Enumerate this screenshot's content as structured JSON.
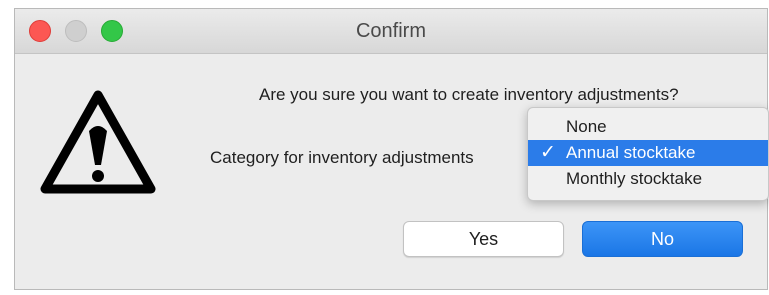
{
  "window": {
    "title": "Confirm",
    "controls": [
      "close",
      "minimize",
      "zoom"
    ]
  },
  "icon": "warning-triangle-icon",
  "message": {
    "question": "Are you sure you want to create inventory adjustments?",
    "category_label": "Category for inventory adjustments"
  },
  "category_menu": {
    "selected": "Annual stocktake",
    "items": [
      {
        "label": "None",
        "checked": false
      },
      {
        "label": "Annual stocktake",
        "checked": true
      },
      {
        "label": "Monthly stocktake",
        "checked": false
      }
    ],
    "check_glyph": "✓"
  },
  "buttons": {
    "yes": "Yes",
    "no": "No"
  },
  "colors": {
    "accent": "#2b7ce9",
    "close": "#fc5753",
    "zoom": "#33c748"
  }
}
